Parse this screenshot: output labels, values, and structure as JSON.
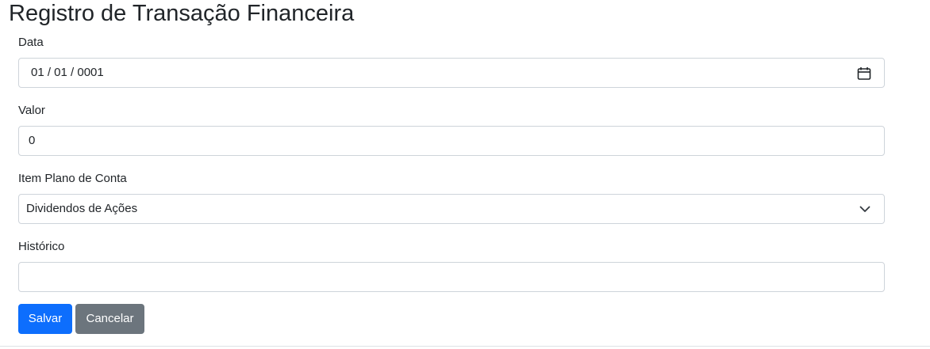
{
  "page": {
    "title": "Registro de Transação Financeira"
  },
  "form": {
    "data": {
      "label": "Data",
      "value": "01 / 01 / 0001"
    },
    "valor": {
      "label": "Valor",
      "value": "0"
    },
    "item_plano_conta": {
      "label": "Item Plano de Conta",
      "selected": "Dividendos de Ações"
    },
    "historico": {
      "label": "Histórico",
      "value": ""
    }
  },
  "buttons": {
    "save_label": "Salvar",
    "cancel_label": "Cancelar"
  },
  "icons": {
    "date_picker": "calendar-icon",
    "select": "chevron-down-icon"
  },
  "colors": {
    "primary": "#0d6efd",
    "secondary": "#6c757d",
    "input_border": "#ced4da",
    "text": "#212529"
  }
}
